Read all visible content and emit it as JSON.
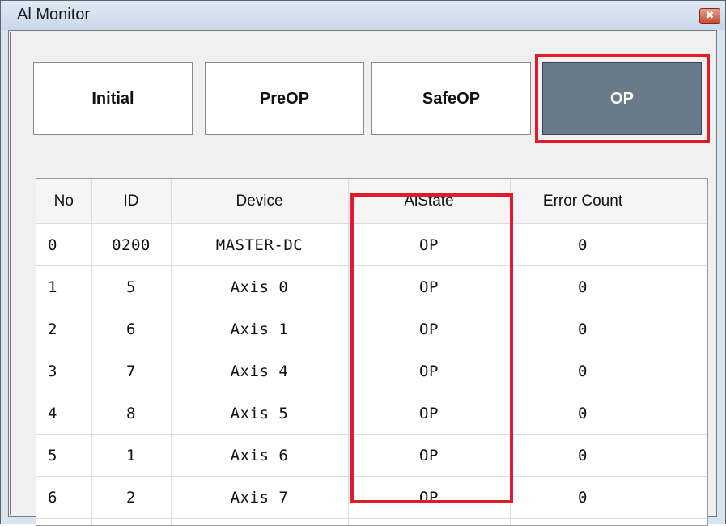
{
  "window": {
    "title": "Al Monitor",
    "close_glyph": "✖"
  },
  "state_buttons": [
    {
      "label": "Initial",
      "active": false
    },
    {
      "label": "PreOP",
      "active": false
    },
    {
      "label": "SafeOP",
      "active": false
    },
    {
      "label": "OP",
      "active": true
    }
  ],
  "table": {
    "columns": [
      "No",
      "ID",
      "Device",
      "AlState",
      "Error Count"
    ],
    "rows": [
      {
        "no": "0",
        "id": "0200",
        "device": "MASTER-DC",
        "state": "OP",
        "errors": "0"
      },
      {
        "no": "1",
        "id": "5",
        "device": "Axis 0",
        "state": "OP",
        "errors": "0"
      },
      {
        "no": "2",
        "id": "6",
        "device": "Axis 1",
        "state": "OP",
        "errors": "0"
      },
      {
        "no": "3",
        "id": "7",
        "device": "Axis 4",
        "state": "OP",
        "errors": "0"
      },
      {
        "no": "4",
        "id": "8",
        "device": "Axis 5",
        "state": "OP",
        "errors": "0"
      },
      {
        "no": "5",
        "id": "1",
        "device": "Axis 6",
        "state": "OP",
        "errors": "0"
      },
      {
        "no": "6",
        "id": "2",
        "device": "Axis 7",
        "state": "OP",
        "errors": "0"
      }
    ]
  },
  "colors": {
    "active_button": "#6b7a8b",
    "highlight": "#e21b2c"
  }
}
